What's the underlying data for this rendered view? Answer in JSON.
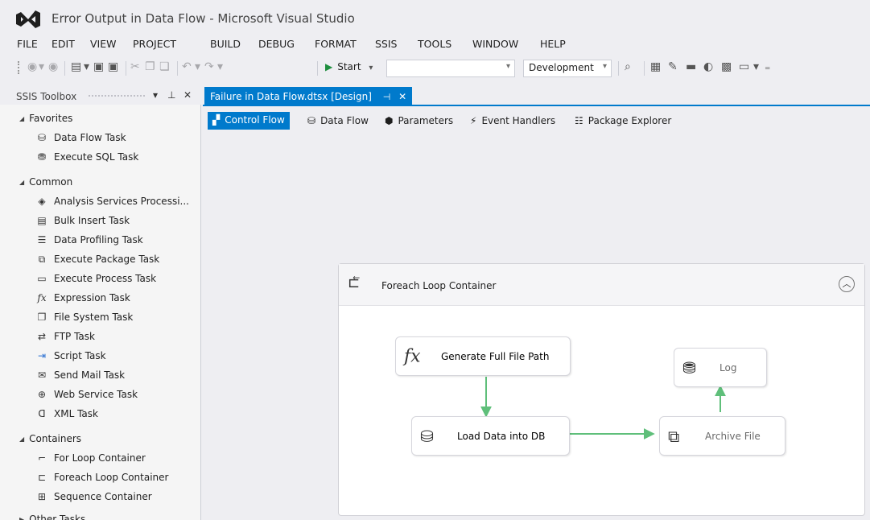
{
  "window": {
    "title": "Error Output in Data Flow - Microsoft Visual Studio"
  },
  "menu": [
    "FILE",
    "EDIT",
    "VIEW",
    "PROJECT",
    "BUILD",
    "DEBUG",
    "FORMAT",
    "SSIS",
    "TOOLS",
    "WINDOW",
    "HELP"
  ],
  "toolbar": {
    "start_label": "Start",
    "solution_config": "Development",
    "debug_target": ""
  },
  "toolbox": {
    "title": "SSIS Toolbox",
    "sections": [
      {
        "name": "Favorites",
        "items": [
          {
            "label": "Data Flow Task",
            "icon": "data-flow-task-icon"
          },
          {
            "label": "Execute SQL Task",
            "icon": "sql-task-icon"
          }
        ]
      },
      {
        "name": "Common",
        "items": [
          {
            "label": "Analysis Services Processi...",
            "icon": "analysis-services-icon"
          },
          {
            "label": "Bulk Insert Task",
            "icon": "bulk-insert-icon"
          },
          {
            "label": "Data Profiling Task",
            "icon": "data-profiling-icon"
          },
          {
            "label": "Execute Package Task",
            "icon": "execute-package-icon"
          },
          {
            "label": "Execute Process Task",
            "icon": "execute-process-icon"
          },
          {
            "label": "Expression Task",
            "icon": "expression-icon"
          },
          {
            "label": "File System Task",
            "icon": "file-system-icon"
          },
          {
            "label": "FTP Task",
            "icon": "ftp-icon"
          },
          {
            "label": "Script Task",
            "icon": "script-icon"
          },
          {
            "label": "Send Mail Task",
            "icon": "mail-icon"
          },
          {
            "label": "Web Service Task",
            "icon": "web-service-icon"
          },
          {
            "label": "XML Task",
            "icon": "xml-icon"
          }
        ]
      },
      {
        "name": "Containers",
        "items": [
          {
            "label": "For Loop Container",
            "icon": "for-loop-icon"
          },
          {
            "label": "Foreach Loop Container",
            "icon": "foreach-loop-icon"
          },
          {
            "label": "Sequence Container",
            "icon": "sequence-icon"
          }
        ]
      },
      {
        "name": "Other Tasks",
        "items": []
      }
    ]
  },
  "document_tab": {
    "label": "Failure in Data Flow.dtsx [Design]"
  },
  "designer_tabs": [
    "Control Flow",
    "Data Flow",
    "Parameters",
    "Event Handlers",
    "Package Explorer"
  ],
  "designer": {
    "active_tab": "Control Flow",
    "container": {
      "title": "Foreach Loop Container"
    },
    "tasks": {
      "generate": "Generate Full File Path",
      "load": "Load Data into DB",
      "archive": "Archive File",
      "log": "Log"
    },
    "connector_color": "#5fbf7a"
  }
}
